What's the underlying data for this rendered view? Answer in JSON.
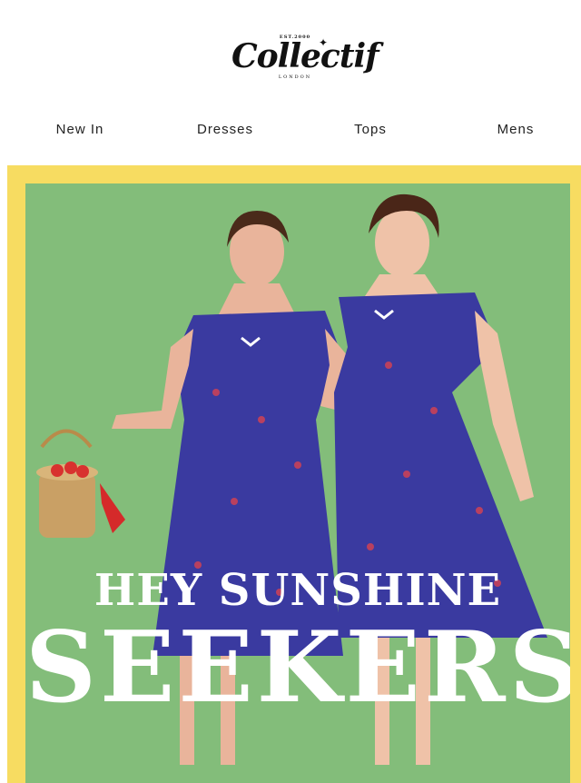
{
  "brand": {
    "est": "EST.2000",
    "name": "Collectif",
    "city": "LONDON"
  },
  "nav": {
    "items": [
      {
        "label": "New In"
      },
      {
        "label": "Dresses"
      },
      {
        "label": "Tops"
      },
      {
        "label": "Mens"
      }
    ]
  },
  "hero": {
    "line1": "HEY SUNSHINE",
    "line2": "SEEKERS",
    "frame_color": "#f7dc61",
    "background_color": "#83bd7a",
    "dress_color": "#3a3aa0"
  }
}
